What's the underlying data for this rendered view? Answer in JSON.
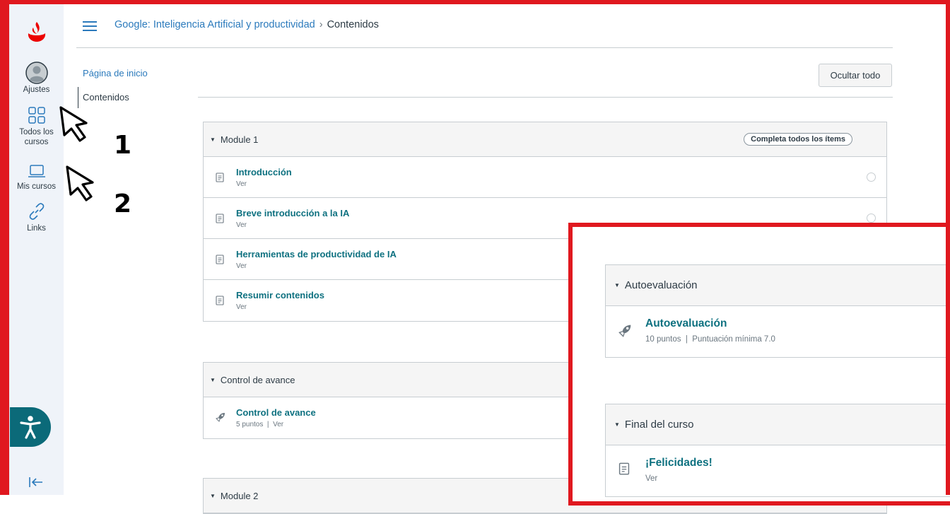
{
  "global_nav": {
    "items": [
      {
        "label": "Ajustes",
        "icon": "account-icon"
      },
      {
        "label": "Todos los cursos",
        "icon": "courses-grid-icon"
      },
      {
        "label": "Mis cursos",
        "icon": "laptop-icon"
      },
      {
        "label": "Links",
        "icon": "link-icon"
      }
    ],
    "accessibility_icon": "accessibility-icon",
    "collapse_icon": "collapse-nav-icon"
  },
  "breadcrumb": {
    "course": "Google: Inteligencia Artificial y productividad",
    "separator": "›",
    "current": "Contenidos"
  },
  "course_nav": {
    "home": "Página de inicio",
    "contents": "Contenidos"
  },
  "toolbar": {
    "collapse_all": "Ocultar todo"
  },
  "modules": [
    {
      "title": "Module 1",
      "requirement": "Completa todos los ítems",
      "items": [
        {
          "title": "Introducción",
          "sub": "Ver"
        },
        {
          "title": "Breve introducción a la IA",
          "sub": "Ver"
        },
        {
          "title": "Herramientas de productividad de IA",
          "sub": "Ver"
        },
        {
          "title": "Resumir contenidos",
          "sub": "Ver"
        }
      ]
    },
    {
      "title": "Control de avance",
      "items": [
        {
          "title": "Control de avance",
          "sub": "5 puntos  |  Ver"
        }
      ]
    },
    {
      "title": "Module 2"
    }
  ],
  "annotations": {
    "marker_1": "1",
    "marker_2": "2"
  },
  "inset": {
    "modules": [
      {
        "title": "Autoevaluación",
        "items": [
          {
            "title": "Autoevaluación",
            "sub": "10 puntos  |  Puntuación mínima 7.0"
          }
        ]
      },
      {
        "title": "Final del curso",
        "items": [
          {
            "title": "¡Felicidades!",
            "sub": "Ver"
          }
        ]
      }
    ]
  },
  "colors": {
    "frame_red": "#e0181f",
    "brand_red": "#ec0000",
    "link_teal": "#0e7180",
    "nav_bg": "#eff3f9",
    "accessibility_teal": "#0b6a79"
  }
}
